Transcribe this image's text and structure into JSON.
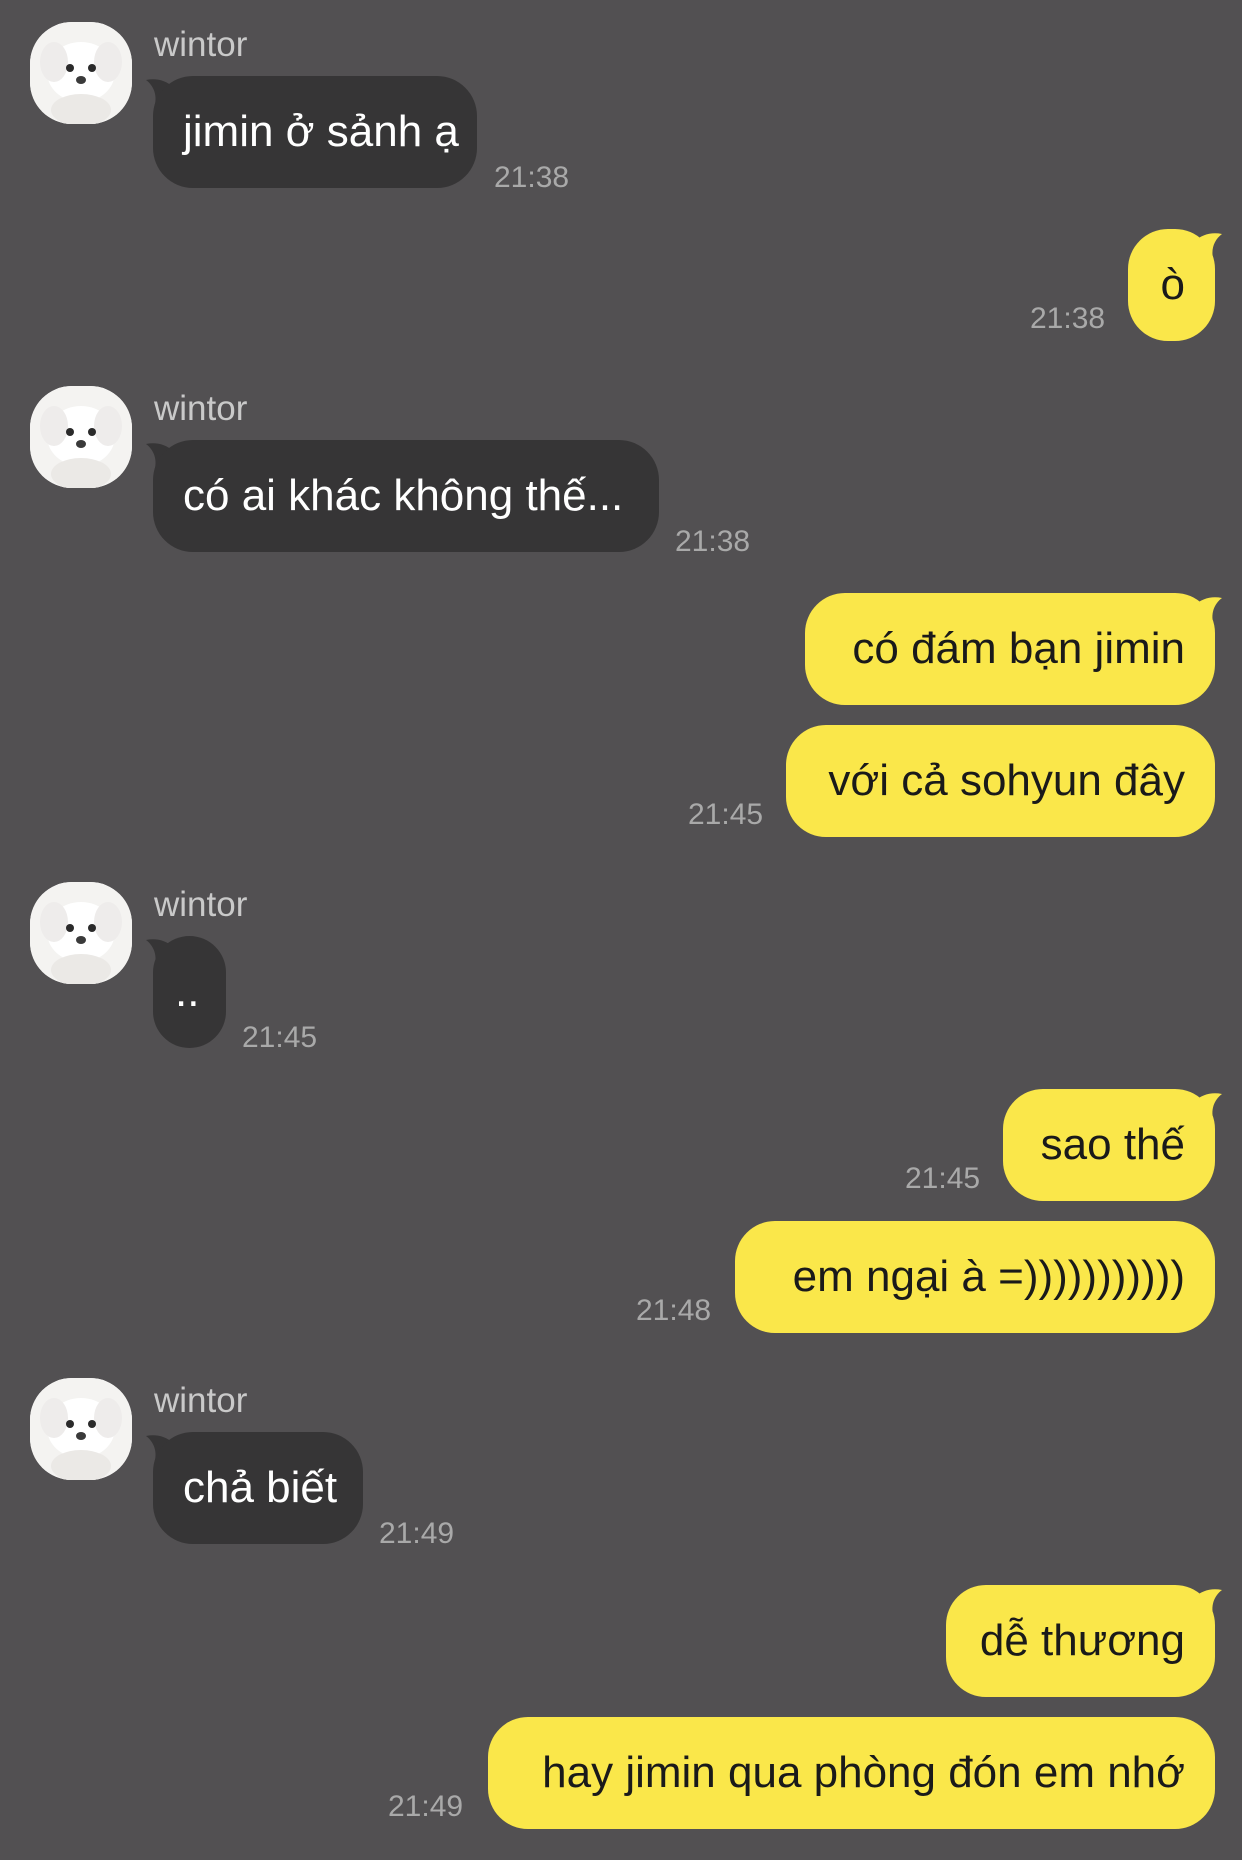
{
  "colors": {
    "background": "#525052",
    "incoming_bubble": "#363536",
    "outgoing_bubble": "#fae74a",
    "incoming_text": "#ffffff",
    "outgoing_text": "#1a1a1a",
    "timestamp": "#a9a9a9",
    "sender_name": "#c9c9c9"
  },
  "contact": {
    "name": "wintor",
    "avatar": "white-puppy-avatar"
  },
  "messages": [
    {
      "from": "wintor",
      "text": "jimin ở sảnh ạ",
      "time": "21:38"
    },
    {
      "from": "me",
      "text": "ò",
      "time": "21:38"
    },
    {
      "from": "wintor",
      "text": "có ai khác không thế...",
      "time": "21:38"
    },
    {
      "from": "me",
      "text": "có đám bạn jimin",
      "time": ""
    },
    {
      "from": "me",
      "text": "với cả sohyun đây",
      "time": "21:45"
    },
    {
      "from": "wintor",
      "text": "..",
      "time": "21:45"
    },
    {
      "from": "me",
      "text": "sao thế",
      "time": "21:45"
    },
    {
      "from": "me",
      "text": "em ngại à =)))))))))))",
      "time": "21:48"
    },
    {
      "from": "wintor",
      "text": "chả biết",
      "time": "21:49"
    },
    {
      "from": "me",
      "text": "dễ thương",
      "time": ""
    },
    {
      "from": "me",
      "text": "hay jimin qua phòng đón em nhớ",
      "time": "21:49"
    }
  ]
}
